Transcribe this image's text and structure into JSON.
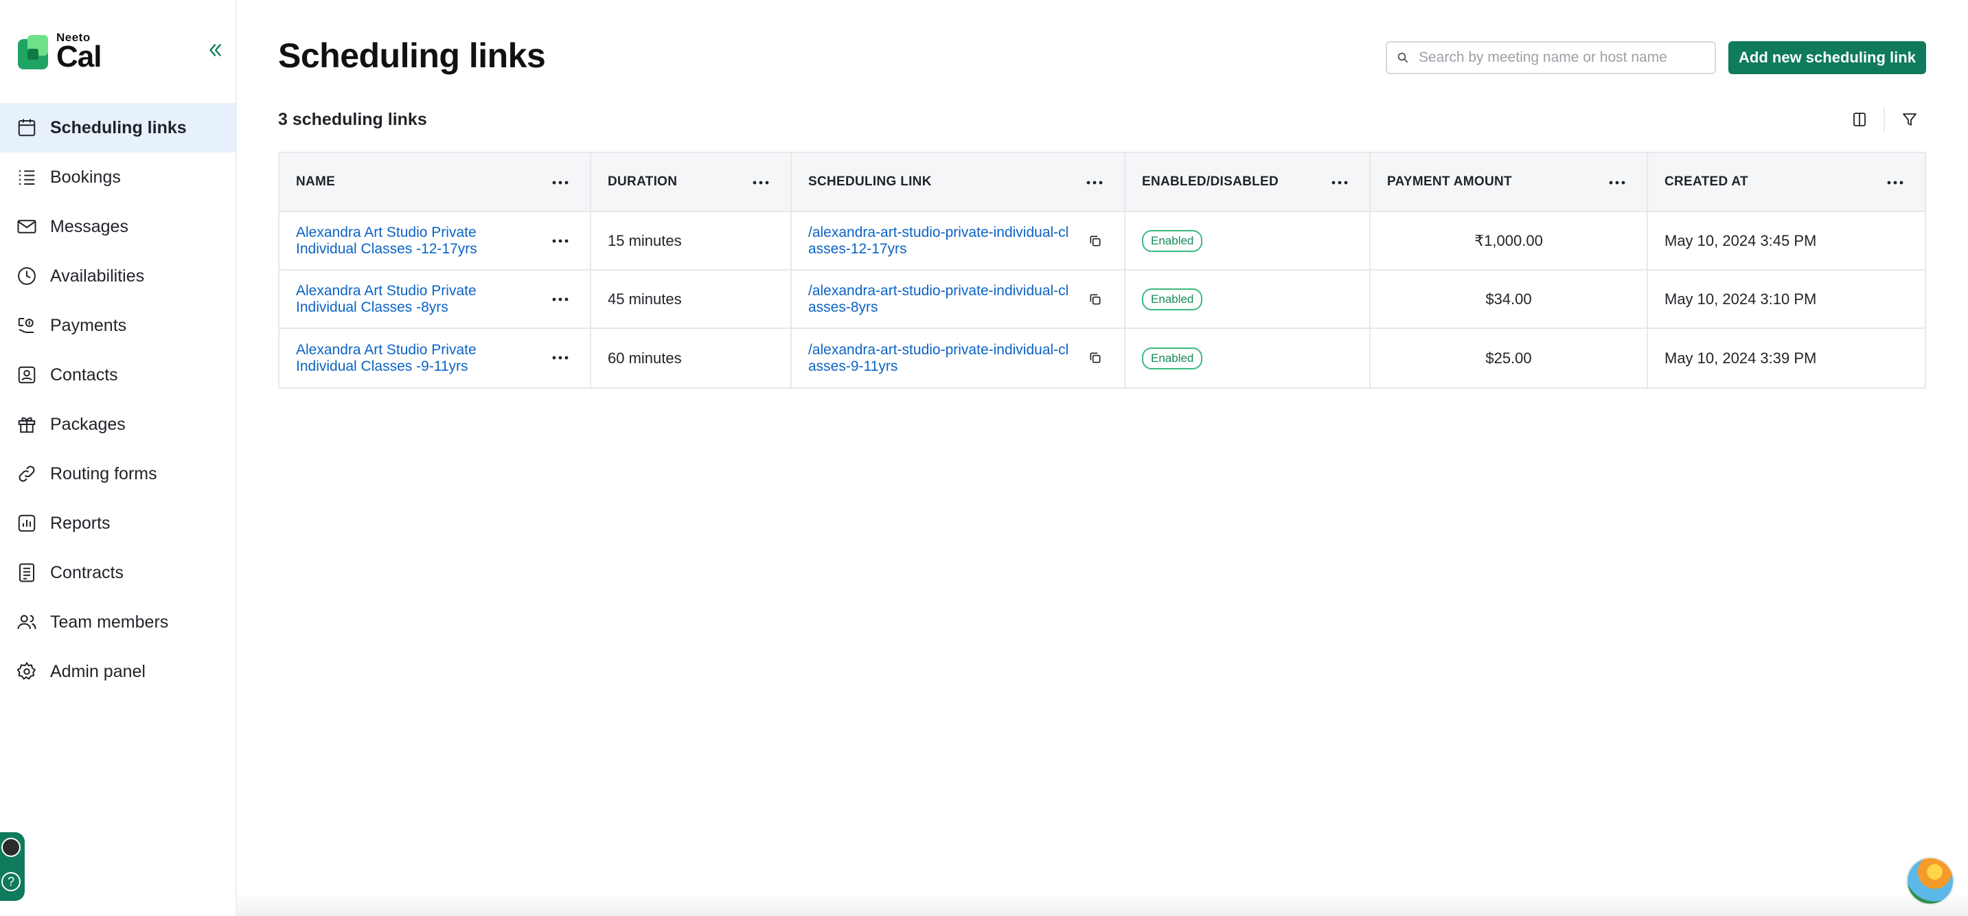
{
  "app": {
    "logo_small": "Neeto",
    "logo_big": "Cal",
    "accent_color": "#0f7a5c"
  },
  "sidebar": {
    "items": [
      {
        "label": "Scheduling links",
        "icon": "calendar-icon",
        "active": true
      },
      {
        "label": "Bookings",
        "icon": "list-icon"
      },
      {
        "label": "Messages",
        "icon": "mail-icon"
      },
      {
        "label": "Availabilities",
        "icon": "clock-icon"
      },
      {
        "label": "Payments",
        "icon": "payment-icon"
      },
      {
        "label": "Contacts",
        "icon": "contact-icon"
      },
      {
        "label": "Packages",
        "icon": "gift-icon"
      },
      {
        "label": "Routing forms",
        "icon": "link-icon"
      },
      {
        "label": "Reports",
        "icon": "report-icon"
      },
      {
        "label": "Contracts",
        "icon": "document-icon"
      },
      {
        "label": "Team members",
        "icon": "users-icon"
      },
      {
        "label": "Admin panel",
        "icon": "gear-icon"
      }
    ]
  },
  "header": {
    "title": "Scheduling links",
    "search_placeholder": "Search by meeting name or host name",
    "add_button": "Add new scheduling link"
  },
  "summary": {
    "count_label": "3 scheduling links"
  },
  "table": {
    "columns": [
      "NAME",
      "DURATION",
      "SCHEDULING LINK",
      "ENABLED/DISABLED",
      "PAYMENT AMOUNT",
      "CREATED AT"
    ],
    "rows": [
      {
        "name": "Alexandra Art Studio Private Individual Classes -12-17yrs",
        "duration": "15 minutes",
        "link": "/alexandra-art-studio-private-individual-classes-12-17yrs",
        "status": "Enabled",
        "amount": "₹1,000.00",
        "created": "May 10, 2024 3:45 PM"
      },
      {
        "name": "Alexandra Art Studio Private Individual Classes -8yrs",
        "duration": "45 minutes",
        "link": "/alexandra-art-studio-private-individual-classes-8yrs",
        "status": "Enabled",
        "amount": "$34.00",
        "created": "May 10, 2024 3:10 PM"
      },
      {
        "name": "Alexandra Art Studio Private Individual Classes -9-11yrs",
        "duration": "60 minutes",
        "link": "/alexandra-art-studio-private-individual-classes-9-11yrs",
        "status": "Enabled",
        "amount": "$25.00",
        "created": "May 10, 2024 3:39 PM"
      }
    ]
  }
}
